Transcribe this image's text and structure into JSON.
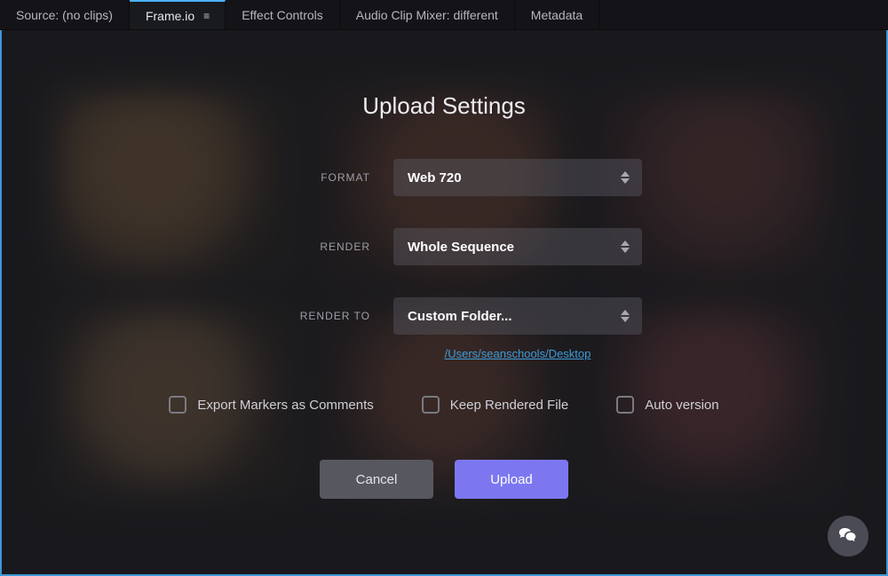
{
  "tabs": [
    {
      "label": "Source: (no clips)"
    },
    {
      "label": "Frame.io"
    },
    {
      "label": "Effect Controls"
    },
    {
      "label": "Audio Clip Mixer: different"
    },
    {
      "label": "Metadata"
    }
  ],
  "dialog": {
    "title": "Upload Settings",
    "fields": {
      "format": {
        "label": "FORMAT",
        "value": "Web 720"
      },
      "render": {
        "label": "RENDER",
        "value": "Whole Sequence"
      },
      "render_to": {
        "label": "RENDER TO",
        "value": "Custom Folder..."
      }
    },
    "path": "/Users/seanschools/Desktop",
    "checks": {
      "export_markers": "Export Markers as Comments",
      "keep_rendered": "Keep Rendered File",
      "auto_version": "Auto version"
    },
    "buttons": {
      "cancel": "Cancel",
      "upload": "Upload"
    }
  }
}
